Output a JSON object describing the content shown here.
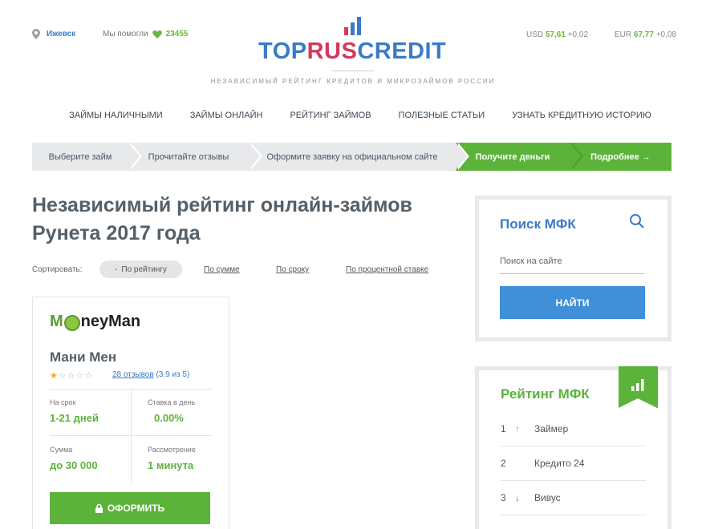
{
  "header": {
    "city": "Ижевск",
    "helped_label": "Мы помогли",
    "helped_count": "23455",
    "usd_label": "USD",
    "usd_value": "57,61",
    "usd_change": "+0,02",
    "eur_label": "EUR",
    "eur_value": "67,77",
    "eur_change": "+0,08",
    "logo_left": "TOP",
    "logo_mid": "RUS",
    "logo_right": "CREDIT",
    "tagline": "НЕЗАВИСИМЫЙ РЕЙТИНГ КРЕДИТОВ И МИКРОЗАЙМОВ РОССИИ",
    "colors": {
      "blue": "#3a7bc8",
      "green": "#5bb33a",
      "red": "#d13a5c"
    }
  },
  "nav": {
    "items": [
      "ЗАЙМЫ НАЛИЧНЫМИ",
      "ЗАЙМЫ ОНЛАЙН",
      "РЕЙТИНГ ЗАЙМОВ",
      "ПОЛЕЗНЫЕ СТАТЬИ",
      "УЗНАТЬ КРЕДИТНУЮ ИСТОРИЮ"
    ]
  },
  "steps": {
    "items": [
      "Выберите займ",
      "Прочитайте отзывы",
      "Оформите заявку на официальном сайте",
      "Получите деньги",
      "Подробнее →"
    ]
  },
  "main": {
    "title": "Независимый рейтинг онлайн-займов Рунета 2017 года",
    "sort_label": "Сортировать:",
    "sort_active": "По рейтингу",
    "sort_links": [
      "По сумме",
      "По сроку",
      "По процентной ставке"
    ]
  },
  "card": {
    "logo_start": "M",
    "logo_end": "neyMan",
    "name": "Мани Мен",
    "rating_stars": 1,
    "reviews_link": "28 отзывов",
    "rating_text": "(3.9 из 5)",
    "stats": {
      "term_label": "На срок",
      "term_value": "1-21 дней",
      "rate_label": "Ставка в день",
      "rate_value": "0.00%",
      "sum_label": "Сумма",
      "sum_value": "до 30 000",
      "review_label": "Рассмотрение",
      "review_value": "1 минута"
    },
    "apply_label": "ОФОРМИТЬ"
  },
  "sidebar": {
    "search_title": "Поиск МФК",
    "search_placeholder": "Поиск на сайте",
    "search_button": "НАЙТИ",
    "rating_title": "Рейтинг МФК",
    "rating_items": [
      {
        "num": "1",
        "trend": "up",
        "name": "Займер"
      },
      {
        "num": "2",
        "trend": "none",
        "name": "Кредито 24"
      },
      {
        "num": "3",
        "trend": "down",
        "name": "Вивус"
      }
    ]
  }
}
